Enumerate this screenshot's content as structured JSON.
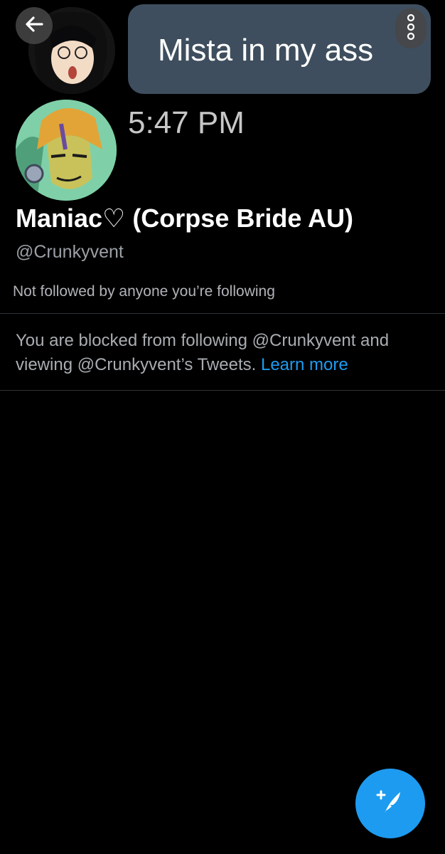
{
  "banner": {
    "message": "Mista in my ass",
    "time": "5:47 PM"
  },
  "profile": {
    "display_name": "Maniac♡ (Corpse Bride AU)",
    "handle": "@Crunkyvent",
    "followers_note": "Not followed by anyone you’re following"
  },
  "blocked_notice": {
    "text": "You are blocked from following @Crunkyvent and viewing @Crunkyvent’s Tweets.",
    "link": "Learn more"
  },
  "icons": {
    "back": "arrow-left-icon",
    "more": "more-vertical-icon",
    "compose": "compose-tweet-icon"
  },
  "colors": {
    "background": "#000000",
    "accent": "#1d9bf0",
    "bubble": "#3e4e5e",
    "divider": "#2f3336"
  }
}
